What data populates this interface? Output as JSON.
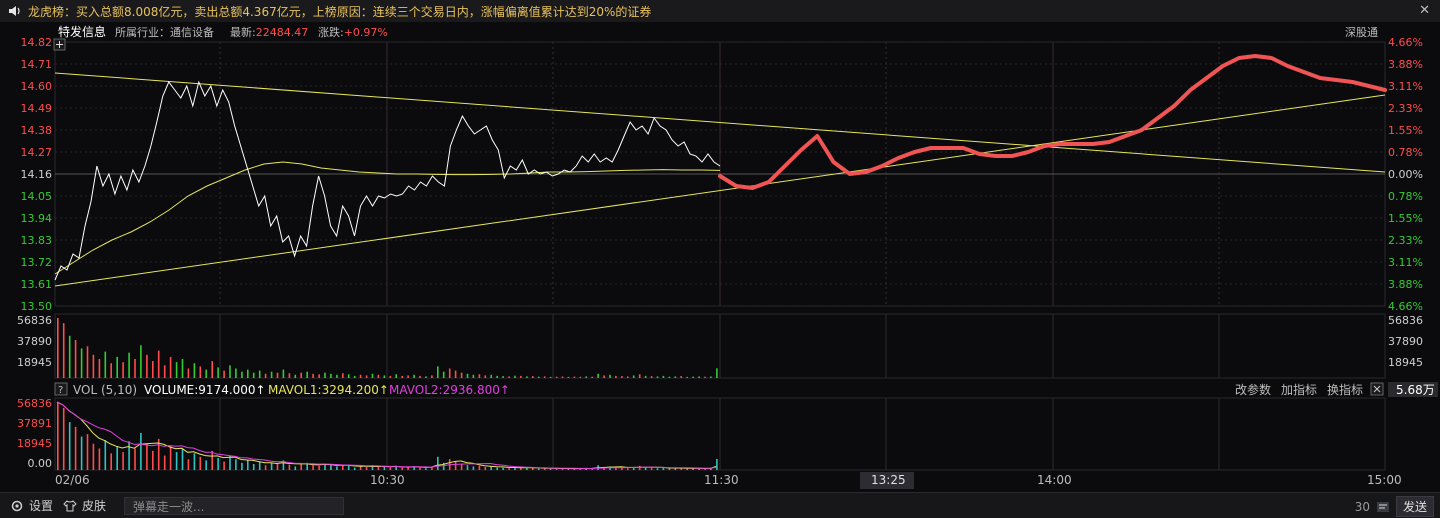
{
  "topbar": {
    "message": "龙虎榜：买入总额8.008亿元，卖出总额4.367亿元，上榜原因：连续三个交易日内，涨幅偏离值累计达到20%的证券",
    "close_icon": "close-icon"
  },
  "header": {
    "tab": "特发信息",
    "industry": "所属行业：通信设备",
    "latest": "最新:22484.47",
    "change": "涨跌:+0.97%",
    "exchange": "深股通"
  },
  "colors": {
    "up": "#ff4d4d",
    "down": "#33cc33",
    "price": "#ffffff",
    "avg": "#e6e65a",
    "forecast": "#f05454",
    "magenta": "#e040e0"
  },
  "price_axis_left": [
    "14.82",
    "14.71",
    "14.60",
    "14.49",
    "14.38",
    "14.27",
    "14.16",
    "14.05",
    "13.94",
    "13.83",
    "13.72",
    "13.61",
    "13.50"
  ],
  "price_axis_right": [
    "4.66%",
    "3.88%",
    "3.11%",
    "2.33%",
    "1.55%",
    "0.78%",
    "0.00%",
    "0.78%",
    "1.55%",
    "2.33%",
    "3.11%",
    "3.88%",
    "4.66%"
  ],
  "volume_axis": [
    "56836",
    "37890",
    "18945"
  ],
  "indicator": {
    "name": "VOL (5,10)",
    "volume": "VOLUME:9174.000↑",
    "mavol1": "MAVOL1:3294.200↑",
    "mavol2": "MAVOL2:2936.800↑",
    "modify": "改参数",
    "add": "加指标",
    "switch": "换指标",
    "unit_value": "5.68万",
    "axis": [
      "56836",
      "37891",
      "18945",
      "0.00"
    ]
  },
  "time_axis": {
    "date": "02/06",
    "t1030": "10:30",
    "t1130": "11:30",
    "cursor": "13:25",
    "t1400": "14:00",
    "t1500": "15:00"
  },
  "bottombar": {
    "settings": "设置",
    "skin": "皮肤",
    "danmu_placeholder": "弹幕走一波...",
    "count": "30",
    "send": "发送"
  },
  "chart_data": {
    "type": "line",
    "price_range": [
      13.5,
      14.82
    ],
    "series": [
      {
        "values": [
          13.63,
          13.7,
          13.68,
          13.76,
          13.74,
          13.9,
          14.02,
          14.2,
          14.1,
          14.16,
          14.06,
          14.15,
          14.08,
          14.18,
          14.12,
          14.2,
          14.3,
          14.42,
          14.55,
          14.62,
          14.58,
          14.54,
          14.6,
          14.5,
          14.62,
          14.55,
          14.6,
          14.5,
          14.58,
          14.52,
          14.4,
          14.3,
          14.2,
          14.1,
          14.0,
          14.05,
          13.9,
          13.95,
          13.82,
          13.85,
          13.75,
          13.85,
          13.8,
          14.0,
          14.15,
          14.05,
          13.9,
          13.85,
          14.0,
          13.95,
          13.85,
          14.0,
          14.05,
          14.0,
          14.05,
          14.04,
          14.06,
          14.05,
          14.06,
          14.1,
          14.08,
          14.12,
          14.1,
          14.15,
          14.12,
          14.1,
          14.3,
          14.38,
          14.45,
          14.4,
          14.36,
          14.38,
          14.4,
          14.33,
          14.28,
          14.14,
          14.2,
          14.18,
          14.23,
          14.16,
          14.18,
          14.16,
          14.17,
          14.15,
          14.16,
          14.18,
          14.17,
          14.2,
          14.25,
          14.22,
          14.26,
          14.22,
          14.24,
          14.22,
          14.28,
          14.35,
          14.42,
          14.38,
          14.4,
          14.36,
          14.44,
          14.4,
          14.38,
          14.33,
          14.3,
          14.32,
          14.26,
          14.25,
          14.22,
          14.26,
          14.22,
          14.2
        ]
      },
      {
        "values": [
          13.66,
          13.72,
          13.78,
          13.83,
          13.87,
          13.92,
          13.98,
          14.05,
          14.1,
          14.14,
          14.18,
          14.21,
          14.22,
          14.21,
          14.19,
          14.18,
          14.17,
          14.165,
          14.16,
          14.16,
          14.158,
          14.157,
          14.157,
          14.158,
          14.16,
          14.165,
          14.17,
          14.17,
          14.172,
          14.175,
          14.178,
          14.18,
          14.182,
          14.18,
          14.18,
          14.178
        ]
      },
      {
        "values": [
          14.15,
          14.1,
          14.09,
          14.12,
          14.2,
          14.28,
          14.35,
          14.22,
          14.16,
          14.17,
          14.2,
          14.24,
          14.27,
          14.29,
          14.29,
          14.29,
          14.26,
          14.25,
          14.25,
          14.27,
          14.3,
          14.31,
          14.31,
          14.31,
          14.32,
          14.35,
          14.38,
          14.44,
          14.5,
          14.58,
          14.64,
          14.7,
          14.74,
          14.75,
          14.74,
          14.7,
          14.67,
          14.64,
          14.63,
          14.62,
          14.6,
          14.58
        ]
      }
    ],
    "volume": [
      56836,
      52000,
      40000,
      36000,
      28000,
      30000,
      22000,
      18000,
      25000,
      14000,
      20000,
      15000,
      24000,
      18000,
      31000,
      22000,
      16000,
      26000,
      12000,
      20000,
      15000,
      18000,
      9000,
      14000,
      11000,
      8000,
      16000,
      10000,
      7000,
      12000,
      9000,
      6000,
      8000,
      5000,
      7000,
      4000,
      6000,
      5000,
      8000,
      4500,
      3000,
      5000,
      6000,
      4000,
      3500,
      5000,
      4000,
      3000,
      4500,
      3500,
      2000,
      3000,
      2500,
      4000,
      3000,
      2500,
      2000,
      3500,
      2000,
      2500,
      3000,
      2000,
      1500,
      2500,
      11000,
      6000,
      9000,
      7000,
      5000,
      4000,
      3000,
      3500,
      2500,
      3000,
      2000,
      1800,
      1500,
      2200,
      2000,
      1500,
      1800,
      1200,
      1500,
      1000,
      1200,
      1400,
      1000,
      1300,
      1100,
      1500,
      1200,
      4000,
      2500,
      3000,
      2000,
      1800,
      1500,
      2500,
      3500,
      2000,
      1800,
      1500,
      2000,
      1200,
      1500,
      1800,
      1000,
      1300,
      1500,
      1200,
      1400,
      9174
    ]
  }
}
